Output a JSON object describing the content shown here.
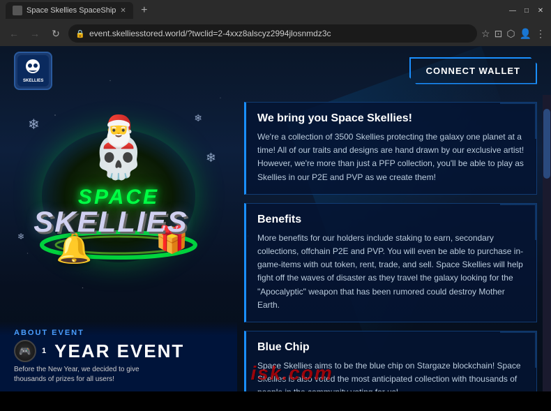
{
  "browser": {
    "tab_title": "Space Skellies SpaceShip",
    "url": "event.skelliesstored.world/?twclid=2-4xxz8alscyz2994jlosnmdz3c",
    "new_tab_icon": "+",
    "nav": {
      "back": "←",
      "forward": "→",
      "refresh": "↻"
    },
    "toolbar": {
      "star": "☆",
      "cast": "⊡",
      "extensions": "⬡",
      "profile": "👤",
      "menu": "⋮"
    }
  },
  "website": {
    "connect_wallet_btn": "CONNECT WALLET",
    "logo": {
      "space_text": "SPACE",
      "skellies_text": "SKELLIES"
    },
    "panels": [
      {
        "title": "We bring you Space Skellies!",
        "text": "We're a collection of 3500 Skellies protecting the galaxy one planet at a time! All of our traits and designs are hand drawn by our exclusive artist! However, we're more than just a PFP collection, you'll be able to play as Skellies in our P2E and PVP as we create them!"
      },
      {
        "title": "Benefits",
        "text": "More benefits for our holders include staking to earn, secondary collections, offchain P2E and PVP. You will even be able to purchase in-game-items with out token, rent, trade, and sell. Space Skellies will help fight off the waves of disaster as they travel the galaxy looking for the \"Apocalyptic\" weapon that has been rumored could destroy Mother Earth."
      },
      {
        "title": "Blue Chip",
        "text": "Space Skellies aims to be the blue chip on Stargaze blockchain! Space Skellies is also voted the most anticipated collection with thousands of people in the community voting for us!"
      }
    ],
    "about_event": {
      "label": "ABOUT EVENT",
      "year_event": "YEAR EVENT",
      "desc_1": "Before the New Year, we decided to give",
      "desc_2": "thousands of prizes for all users!"
    },
    "watermark": "isk.com"
  }
}
